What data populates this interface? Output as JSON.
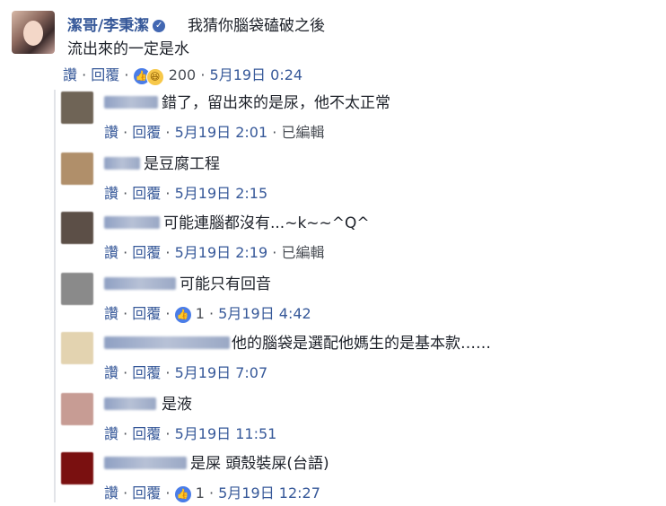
{
  "main_comment": {
    "author": "潔哥/李秉潔",
    "text_line1": "我猜你腦袋磕破之後",
    "text_line2": "流出來的一定是水",
    "like_label": "讚",
    "separator": "·",
    "reply_label": "回覆",
    "reaction_count": "200",
    "timestamp": "5月19日 0:24"
  },
  "replies": [
    {
      "text": "錯了，留出來的是尿，他不太正常",
      "timestamp": "5月19日 2:01",
      "edited": "已編輯",
      "likes": ""
    },
    {
      "text": "是豆腐工程",
      "timestamp": "5月19日 2:15",
      "edited": "",
      "likes": ""
    },
    {
      "text": "可能連腦都沒有...~k~~^Q^",
      "timestamp": "5月19日 2:19",
      "edited": "已編輯",
      "likes": ""
    },
    {
      "text": "可能只有回音",
      "timestamp": "5月19日 4:42",
      "edited": "",
      "likes": "1"
    },
    {
      "text": "他的腦袋是選配他媽生的是基本款……",
      "timestamp": "5月19日 7:07",
      "edited": "",
      "likes": ""
    },
    {
      "text": "是液",
      "timestamp": "5月19日 11:51",
      "edited": "",
      "likes": ""
    },
    {
      "text": "是屎 頭殼裝屎(台語)",
      "timestamp": "5月19日 12:27",
      "edited": "",
      "likes": "1"
    }
  ],
  "colors": {
    "link": "#365899",
    "meta": "#4b4f56",
    "like_blue": "#4a7de8",
    "haha_yellow": "#f7c84a"
  },
  "icons": [
    "verified-badge-icon",
    "like-reaction-icon",
    "haha-reaction-icon"
  ]
}
